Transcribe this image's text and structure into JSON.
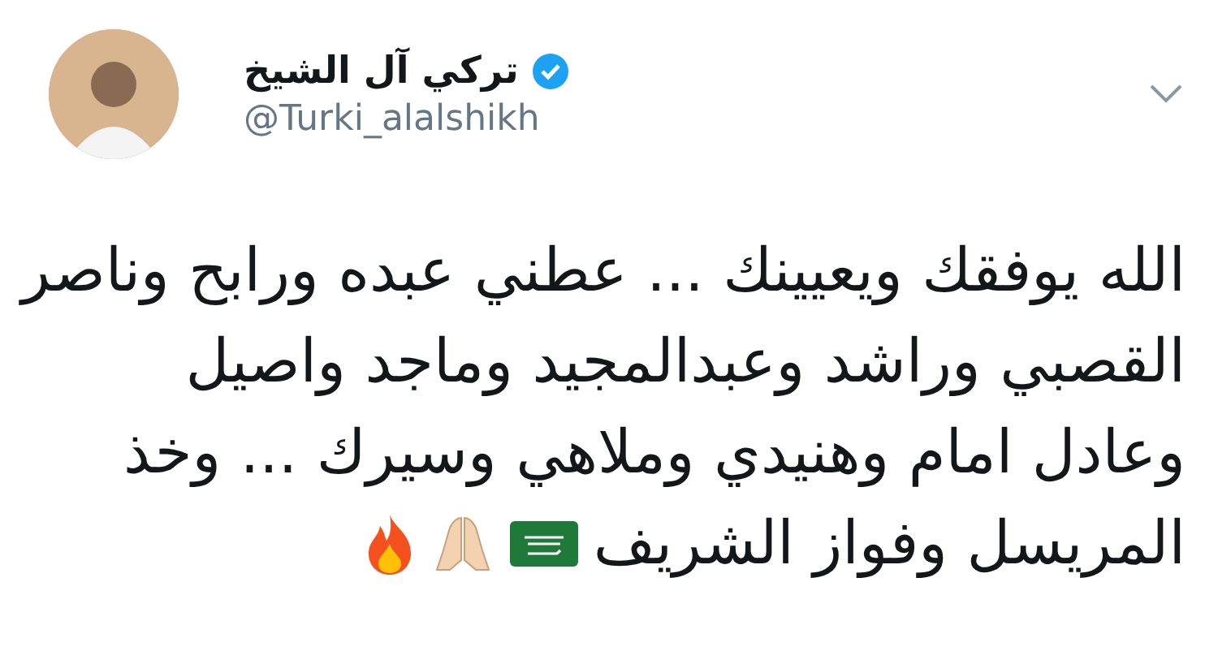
{
  "tweet": {
    "author": {
      "name": "تركي آل الشيخ",
      "verified": true,
      "handle": "@Turki_alalshikh"
    },
    "text_lines": [
      {
        "text": "الله يوفقك ويعيينك ... عطني عبده ورابح وناصر"
      },
      {
        "text": "القصبي وراشد وعبدالمجيد وماجد واصيل"
      },
      {
        "text": "وعادل امام وهنيدي وملاهي وسيرك ... وخذ"
      },
      {
        "text": "المريسل وفواز الشريف",
        "emoji": [
          {
            "kind": "flag"
          },
          {
            "kind": "hands"
          },
          {
            "kind": "fire"
          }
        ]
      }
    ]
  }
}
